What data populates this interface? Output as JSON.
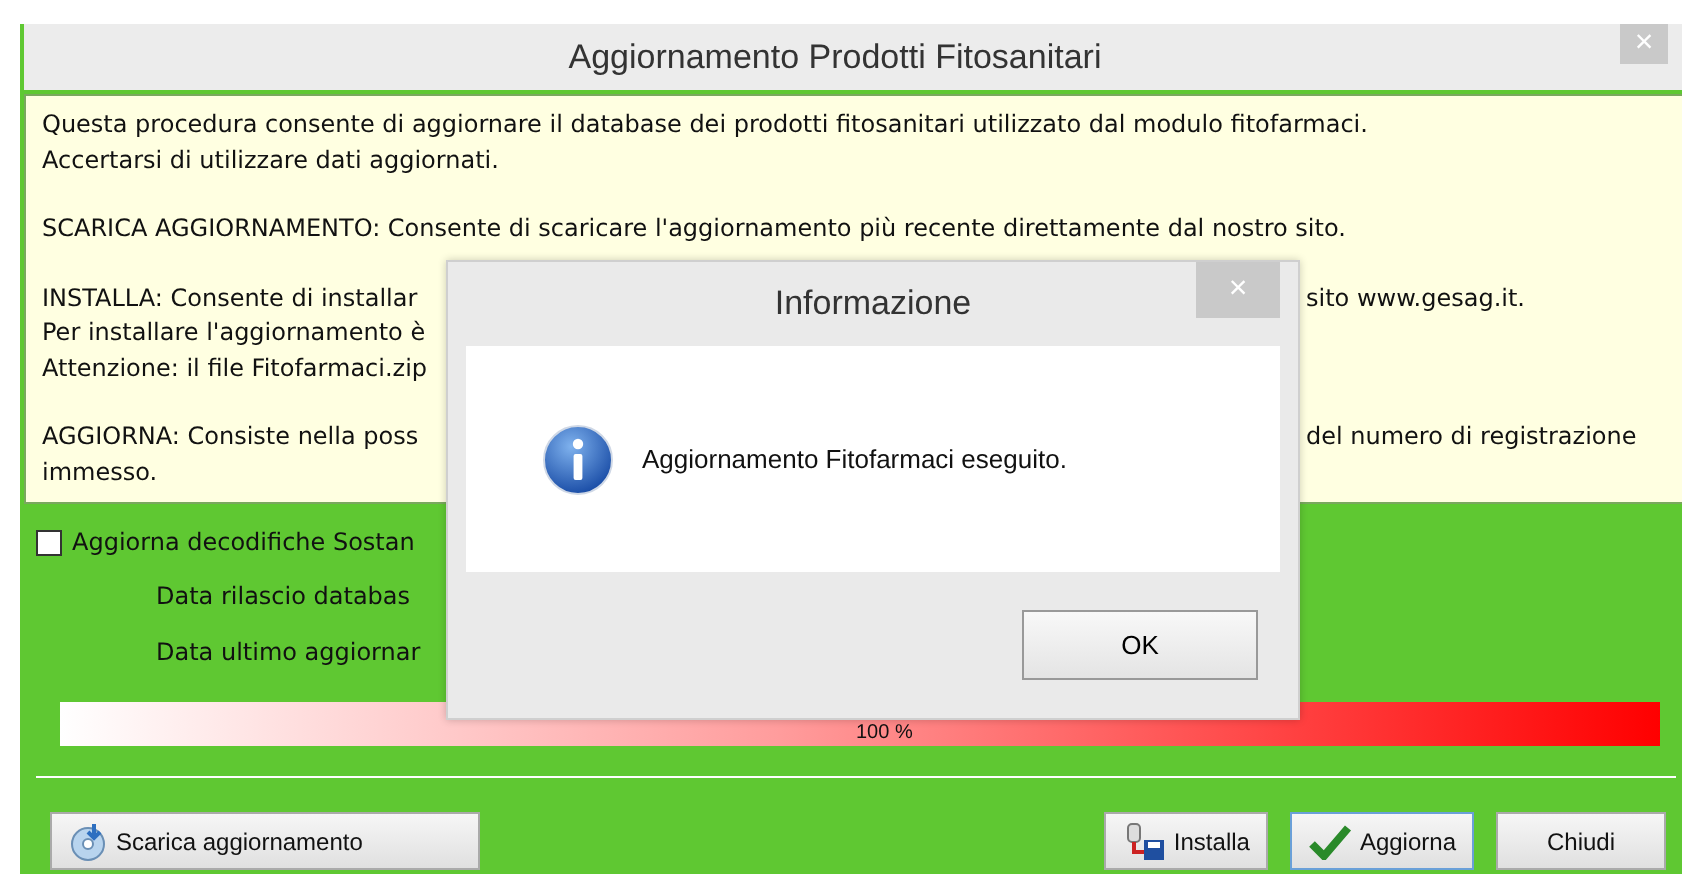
{
  "window": {
    "title": "Aggiornamento Prodotti Fitosanitari",
    "close": "×"
  },
  "info_paragraphs": [
    [
      {
        "left": "Questa procedura consente di aggiornare il database dei prodotti fitosanitari utilizzato dal modulo fitofarmaci."
      },
      {
        "left": "Accertarsi di utilizzare dati aggiornati."
      }
    ],
    [
      {
        "left": "SCARICA AGGIORNAMENTO: Consente di scaricare l'aggiornamento più recente direttamente dal nostro sito."
      }
    ],
    [
      {
        "left": "INSTALLA: Consente di installar",
        "right": "sito www.gesag.it."
      },
      {
        "left": "Per installare l'aggiornamento è"
      },
      {
        "left": "Attenzione: il file Fitofarmaci.zip"
      }
    ],
    [
      {
        "left": "AGGIORNA: Consiste nella poss",
        "right": "del numero di registrazione"
      },
      {
        "left": "immesso."
      }
    ]
  ],
  "checkbox": {
    "label": "Aggiorna decodifiche Sostan",
    "checked": false
  },
  "dates": [
    "Data rilascio databas",
    "Data ultimo aggiornar"
  ],
  "progress": {
    "level": 1,
    "label": "100 %"
  },
  "buttons": [
    {
      "label": "Scarica aggiornamento",
      "kind": "download"
    },
    {
      "label": "Installa",
      "kind": "install"
    },
    {
      "label": "Aggiorna",
      "kind": "update"
    },
    {
      "label": "Chiudi",
      "kind": "close"
    }
  ],
  "dialog": {
    "title": "Informazione",
    "close": "×",
    "message": "Aggiornamento Fitofarmaci eseguito.",
    "button": "OK"
  }
}
